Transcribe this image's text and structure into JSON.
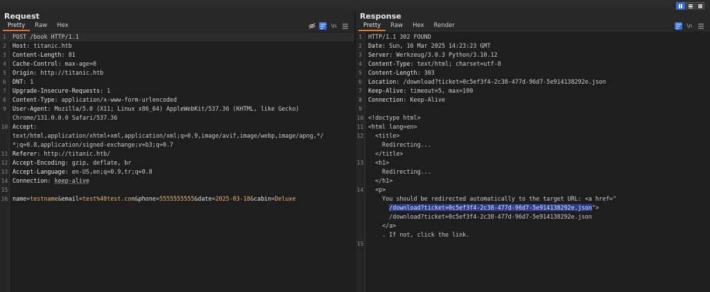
{
  "layout_buttons": [
    "split-horizontal-icon",
    "split-vertical-icon",
    "single-pane-icon"
  ],
  "request": {
    "title": "Request",
    "tabs": [
      "Pretty",
      "Raw",
      "Hex"
    ],
    "active_tab": "Pretty",
    "lines": [
      {
        "n": "1",
        "t": "POST /book HTTP/1.1"
      },
      {
        "n": "2",
        "k": "Host",
        "v": "titanic.htb"
      },
      {
        "n": "3",
        "k": "Content-Length",
        "v": "81"
      },
      {
        "n": "4",
        "k": "Cache-Control",
        "v": "max-age=0"
      },
      {
        "n": "5",
        "k": "Origin",
        "v": "http://titanic.htb"
      },
      {
        "n": "6",
        "k": "DNT",
        "v": "1"
      },
      {
        "n": "7",
        "k": "Upgrade-Insecure-Requests",
        "v": "1"
      },
      {
        "n": "8",
        "k": "Content-Type",
        "v": "application/x-www-form-urlencoded"
      },
      {
        "n": "9",
        "k": "User-Agent",
        "v": "Mozilla/5.0 (X11; Linux x86_64) AppleWebKit/537.36 (KHTML, like Gecko)"
      },
      {
        "n": "",
        "t": "Chrome/131.0.0.0 Safari/537.36"
      },
      {
        "n": "10",
        "k": "Accept",
        "v": ""
      },
      {
        "n": "",
        "t": "text/html,application/xhtml+xml,application/xml;q=0.9,image/avif,image/webp,image/apng,*/"
      },
      {
        "n": "",
        "t": "*;q=0.8,application/signed-exchange;v=b3;q=0.7"
      },
      {
        "n": "11",
        "k": "Referer",
        "v": "http://titanic.htb/"
      },
      {
        "n": "12",
        "k": "Accept-Encoding",
        "v": "gzip, deflate, br"
      },
      {
        "n": "13",
        "k": "Accept-Language",
        "v": "en-US,en;q=0.9,tr;q=0.8"
      },
      {
        "n": "14",
        "k": "Connection",
        "v": "keep-alive"
      },
      {
        "n": "15",
        "t": ""
      },
      {
        "n": "16",
        "body": [
          {
            "k": "name",
            "v": "testname"
          },
          {
            "k": "email",
            "v": "test%40test.com"
          },
          {
            "k": "phone",
            "v": "5555555555"
          },
          {
            "k": "date",
            "v": "2025-03-18"
          },
          {
            "k": "cabin",
            "v": "Deluxe"
          }
        ]
      }
    ]
  },
  "response": {
    "title": "Response",
    "tabs": [
      "Pretty",
      "Raw",
      "Hex",
      "Render"
    ],
    "active_tab": "Pretty",
    "lines": [
      {
        "n": "1",
        "t": "HTTP/1.1 302 FOUND"
      },
      {
        "n": "2",
        "k": "Date",
        "v": "Sun, 16 Mar 2025 14:23:23 GMT"
      },
      {
        "n": "3",
        "k": "Server",
        "v": "Werkzeug/3.0.3 Python/3.10.12"
      },
      {
        "n": "4",
        "k": "Content-Type",
        "v": "text/html; charset=utf-8"
      },
      {
        "n": "5",
        "k": "Content-Length",
        "v": "303"
      },
      {
        "n": "6",
        "k": "Location",
        "v": "/download?ticket=0c5ef3f4-2c38-477d-96d7-5e914138292e.json"
      },
      {
        "n": "7",
        "k": "Keep-Alive",
        "v": "timeout=5, max=100"
      },
      {
        "n": "8",
        "k": "Connection",
        "v": "Keep-Alive"
      },
      {
        "n": "9",
        "t": ""
      },
      {
        "n": "10",
        "t": "<!doctype html>"
      },
      {
        "n": "11",
        "t": "<html lang=en>"
      },
      {
        "n": "12",
        "t": "  <title>"
      },
      {
        "n": "",
        "t": "    Redirecting..."
      },
      {
        "n": "",
        "t": "  </title>"
      },
      {
        "n": "13",
        "t": "  <h1>"
      },
      {
        "n": "",
        "t": "    Redirecting..."
      },
      {
        "n": "",
        "t": "  </h1>"
      },
      {
        "n": "14",
        "t": "  <p>"
      },
      {
        "n": "",
        "t": "    You should be redirected automatically to the target URL: <a href=\""
      },
      {
        "n": "",
        "sel": "/download?ticket=0c5ef3f4-2c38-477d-96d7-5e914138292e.json",
        "after": "\">"
      },
      {
        "n": "",
        "t": "      /download?ticket=0c5ef3f4-2c38-477d-96d7-5e914138292e.json"
      },
      {
        "n": "",
        "t": "    </a>"
      },
      {
        "n": "",
        "t": "    . If not, click the link."
      },
      {
        "n": "15",
        "t": ""
      }
    ]
  }
}
